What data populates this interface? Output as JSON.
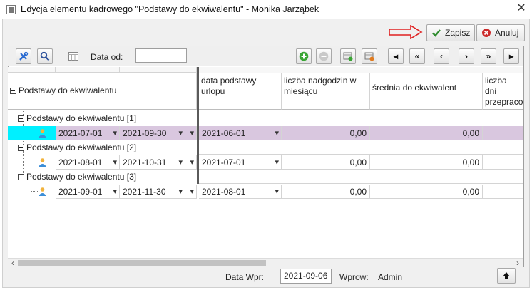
{
  "window": {
    "title": "Edycja elementu kadrowego \"Podstawy do ekwiwalentu\" - Monika Jarząbek",
    "close_glyph": "✕"
  },
  "actions": {
    "save_label": "Zapisz",
    "cancel_label": "Anuluj",
    "save_icon": "checkmark-icon",
    "cancel_icon": "cancel-circle-icon",
    "hint_arrow_color": "#e02020"
  },
  "toolbar": {
    "date_from_label": "Data od:",
    "date_from_value": "",
    "nav": {
      "first": "◂",
      "prev_page": "«",
      "prev": "‹",
      "next": "›",
      "next_page": "»",
      "last": "▸"
    },
    "add_glyph": "+",
    "remove_glyph": "−"
  },
  "grid": {
    "columns": {
      "tree": "Podstawy do ekwiwalentu",
      "urlop": "data podstawy urlopu",
      "nadgodzin": "liczba nadgodzin w miesiącu",
      "srednia": "średnia do ekwiwalent",
      "dni": "liczba dni przepraco"
    },
    "groups": [
      {
        "label": "Podstawy do ekwiwalentu [1]",
        "date_from": "2021-07-01",
        "date_to": "2021-09-30",
        "urlop": "2021-06-01",
        "nadgodzin": "0,00",
        "srednia": "0,00",
        "selected": true
      },
      {
        "label": "Podstawy do ekwiwalentu [2]",
        "date_from": "2021-08-01",
        "date_to": "2021-10-31",
        "urlop": "2021-07-01",
        "nadgodzin": "0,00",
        "srednia": "0,00",
        "selected": false
      },
      {
        "label": "Podstawy do ekwiwalentu [3]",
        "date_from": "2021-09-01",
        "date_to": "2021-11-30",
        "urlop": "2021-08-01",
        "nadgodzin": "0,00",
        "srednia": "0,00",
        "selected": false
      }
    ]
  },
  "footer": {
    "data_wpr_label": "Data Wpr:",
    "data_wpr_value": "2021-09-06",
    "wprow_label": "Wprow:",
    "wprow_value": "Admin",
    "up_glyph": "🡅"
  },
  "colors": {
    "selected_row": "#d9c7df",
    "selected_indicator": "#00f0ff",
    "save_check": "#2e8b2e",
    "cancel_red": "#cc2a2a",
    "add_green": "#3aa535"
  }
}
